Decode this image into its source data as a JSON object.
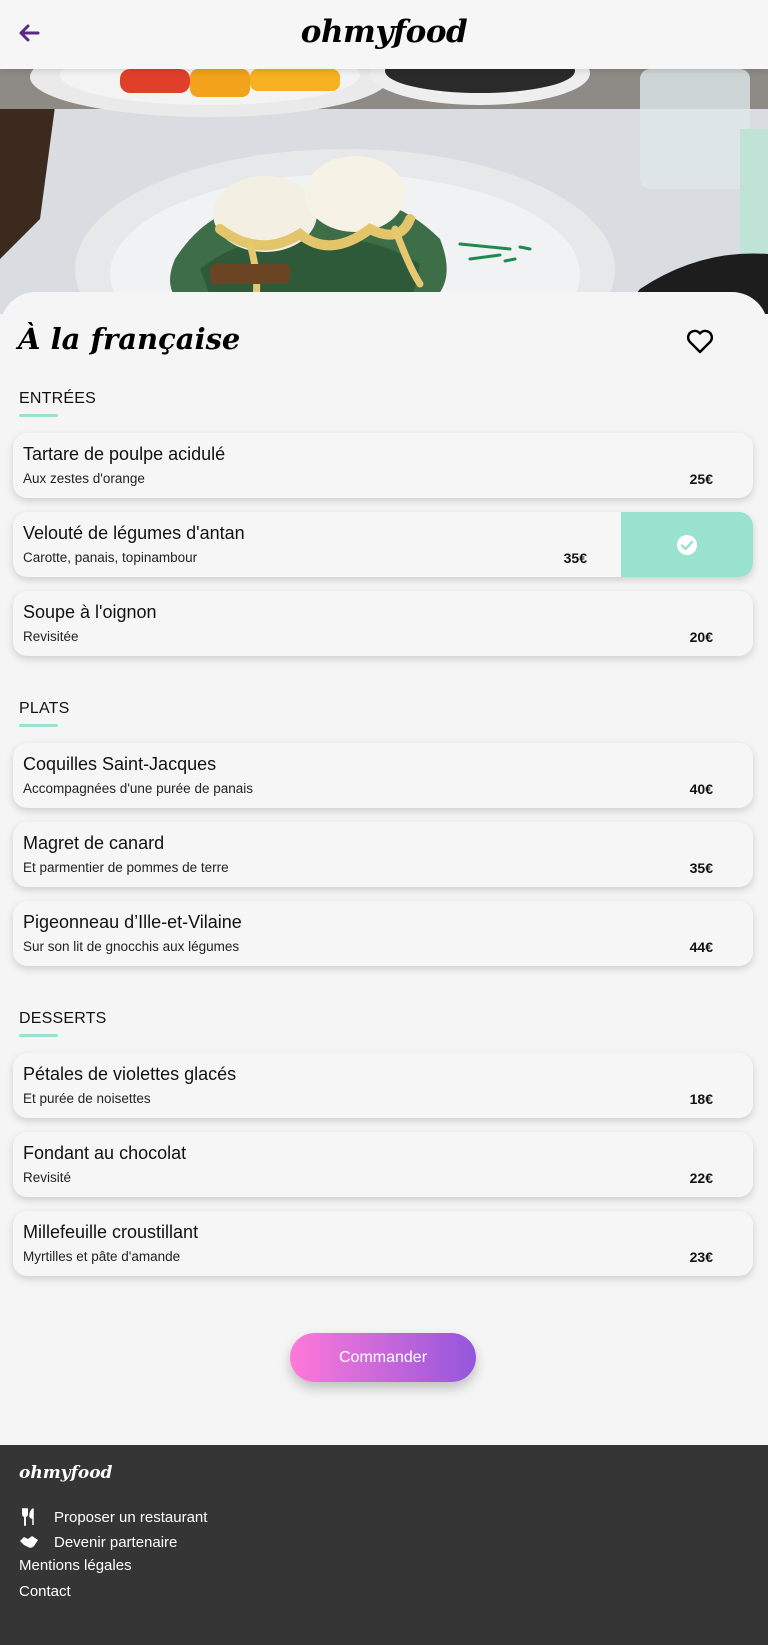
{
  "header": {
    "logo": "ohmyfood",
    "back_icon": "arrow-left-icon",
    "back_color": "#5b2a86"
  },
  "restaurant": {
    "title": "À la française",
    "favorite_icon": "heart-outline-icon"
  },
  "menu": {
    "sections": [
      {
        "title": "ENTRÉES",
        "dishes": [
          {
            "name": "Tartare de poulpe acidulé",
            "description": "Aux zestes d'orange",
            "price": "25€",
            "selected": false
          },
          {
            "name": "Velouté de légumes d'antan",
            "description": "Carotte, panais, topinambour",
            "price": "35€",
            "selected": true
          },
          {
            "name": "Soupe à l'oignon",
            "description": "Revisitée",
            "price": "20€",
            "selected": false
          }
        ]
      },
      {
        "title": "PLATS",
        "dishes": [
          {
            "name": "Coquilles Saint-Jacques",
            "description": "Accompagnées d'une purée de panais",
            "price": "40€",
            "selected": false
          },
          {
            "name": "Magret de canard",
            "description": "Et parmentier de pommes de terre",
            "price": "35€",
            "selected": false
          },
          {
            "name": "Pigeonneau d’Ille-et-Vilaine",
            "description": "Sur son lit de gnocchis aux légumes",
            "price": "44€",
            "selected": false
          }
        ]
      },
      {
        "title": "DESSERTS",
        "dishes": [
          {
            "name": "Pétales de violettes glacés",
            "description": "Et purée de noisettes",
            "price": "18€",
            "selected": false
          },
          {
            "name": "Fondant au chocolat",
            "description": "Revisité",
            "price": "22€",
            "selected": false
          },
          {
            "name": "Millefeuille croustillant",
            "description": "Myrtilles et pâte d'amande",
            "price": "23€",
            "selected": false
          }
        ]
      }
    ]
  },
  "order_button": {
    "label": "Commander"
  },
  "footer": {
    "logo": "ohmyfood",
    "links": [
      {
        "label": "Proposer un restaurant",
        "icon": "utensils-icon"
      },
      {
        "label": "Devenir partenaire",
        "icon": "handshake-icon"
      },
      {
        "label": "Mentions légales",
        "icon": ""
      },
      {
        "label": "Contact",
        "icon": ""
      }
    ]
  },
  "colors": {
    "accent_mint": "#99e2d0",
    "gradient_pink": "#ff79da",
    "gradient_purple": "#9356dc",
    "footer_bg": "#353535"
  }
}
